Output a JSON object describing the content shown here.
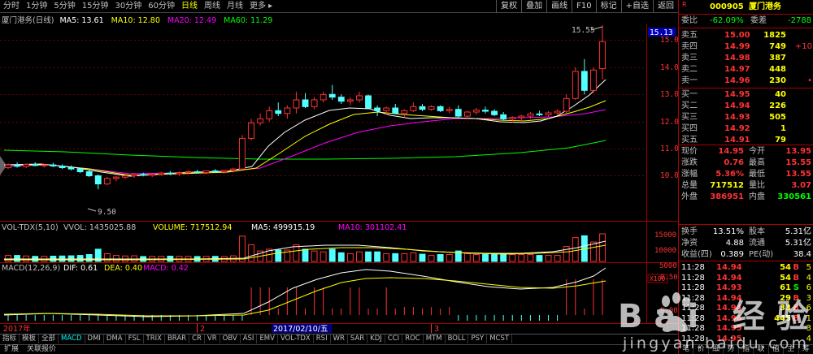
{
  "toolbar": {
    "timeframes": [
      "分时",
      "1分钟",
      "5分钟",
      "15分钟",
      "30分钟",
      "60分钟",
      "日线",
      "周线",
      "月线",
      "更多 ▸"
    ],
    "active_timeframe": "日线",
    "right_buttons": [
      "复权",
      "叠加",
      "画线",
      "F10",
      "标记",
      "+自选",
      "返回"
    ]
  },
  "info": {
    "stock": "厦门港务(日线)",
    "ma5": "MA5: 13.61",
    "ma10": "MA10: 12.80",
    "ma20": "MA20: 12.49",
    "ma60": "MA60: 11.29"
  },
  "price_axis": {
    "labels": [
      "15.00",
      "14.00",
      "13.00",
      "12.00",
      "11.00",
      "10.00"
    ],
    "current_price_tag": "15.13",
    "high_marker": "15.55",
    "low_marker": "9.50"
  },
  "volume_pane": {
    "title": "VOL-TDX(5,10)",
    "vvol": "VVOL: 1435025.88",
    "volume": "VOLUME: 717512.94",
    "ma5": "MA5: 499915.19",
    "ma10": "MA10: 301102.41",
    "axis_labels": [
      "15000",
      "10000",
      "5000"
    ],
    "unit": "X100"
  },
  "macd_pane": {
    "title": "MACD(12,26,9)",
    "dif": "DIF: 0.61",
    "dea": "DEA: 0.40",
    "macd": "MACD: 0.42",
    "axis_labels": [
      "0.50",
      "0.00"
    ]
  },
  "date_axis": {
    "year_label": "2017年",
    "month2": "2",
    "month3": "3",
    "cursor_date": "2017/02/10/五"
  },
  "indicator_tabs": [
    "指标",
    "模板",
    "全部",
    "MACD",
    "DMI",
    "DMA",
    "FSL",
    "TRIX",
    "BRAR",
    "CR",
    "VR",
    "OBV",
    "ASI",
    "EMV",
    "VOL-TDX",
    "RSI",
    "WR",
    "SAR",
    "KDJ",
    "CCI",
    "ROC",
    "MTM",
    "BOLL",
    "PSY",
    "MCST"
  ],
  "active_indicator": "MACD",
  "status_bar": [
    "扩展",
    "关联报价"
  ],
  "quote_panel": {
    "code": "000905",
    "name": "厦门港务",
    "weibi_label": "委比",
    "weibi": "-62.09%",
    "weicha_label": "委差",
    "weicha": "-2788",
    "asks": [
      {
        "label": "卖五",
        "price": "15.00",
        "vol": "1825",
        "chg": ""
      },
      {
        "label": "卖四",
        "price": "14.99",
        "vol": "749",
        "chg": "+10"
      },
      {
        "label": "卖三",
        "price": "14.98",
        "vol": "387",
        "chg": ""
      },
      {
        "label": "卖二",
        "price": "14.97",
        "vol": "448",
        "chg": ""
      },
      {
        "label": "卖一",
        "price": "14.96",
        "vol": "230",
        "chg": "•"
      }
    ],
    "bids": [
      {
        "label": "买一",
        "price": "14.95",
        "vol": "40"
      },
      {
        "label": "买二",
        "price": "14.94",
        "vol": "226"
      },
      {
        "label": "买三",
        "price": "14.93",
        "vol": "505"
      },
      {
        "label": "买四",
        "price": "14.92",
        "vol": "1"
      },
      {
        "label": "买五",
        "price": "14.91",
        "vol": "79"
      }
    ],
    "stats": [
      {
        "l1": "现价",
        "v1": "14.95",
        "l2": "今开",
        "v2": "13.95"
      },
      {
        "l1": "涨跌",
        "v1": "0.76",
        "l2": "最高",
        "v2": "15.55"
      },
      {
        "l1": "涨幅",
        "v1": "5.36%",
        "l2": "最低",
        "v2": "13.55"
      },
      {
        "l1": "总量",
        "v1": "717512",
        "l2": "量比",
        "v2": "3.07"
      },
      {
        "l1": "外盘",
        "v1": "386951",
        "l2": "内盘",
        "v2": "330561"
      }
    ],
    "stats2": [
      {
        "l1": "换手",
        "v1": "13.51%",
        "l2": "股本",
        "v2": "5.31亿"
      },
      {
        "l1": "净资",
        "v1": "4.88",
        "l2": "流通",
        "v2": "5.31亿"
      },
      {
        "l1": "收益(四)",
        "v1": "0.389",
        "l2": "PE(动)",
        "v2": "38.4"
      }
    ],
    "ticks": [
      {
        "time": "11:28",
        "price": "14.94",
        "vol": "54",
        "dir": "B",
        "n": "5"
      },
      {
        "time": "11:28",
        "price": "14.94",
        "vol": "54",
        "dir": "B",
        "n": "4"
      },
      {
        "time": "11:28",
        "price": "14.93",
        "vol": "61",
        "dir": "S",
        "n": "6"
      },
      {
        "time": "11:28",
        "price": "14.94",
        "vol": "29",
        "dir": "B",
        "n": "3"
      },
      {
        "time": "11:28",
        "price": "14.94",
        "vol": "33",
        "dir": "B",
        "n": "6"
      },
      {
        "time": "11:28",
        "price": "14.96",
        "vol": "445",
        "dir": "B",
        "n": "1"
      },
      {
        "time": "11:28",
        "price": "14.95",
        "vol": "",
        "dir": "",
        "n": "3"
      },
      {
        "time": "11:28",
        "price": "14.95",
        "vol": "",
        "dir": "",
        "n": "4"
      }
    ],
    "bottom_tabs": [
      "笔",
      "价",
      "细",
      "势",
      "指",
      "联",
      "值",
      "主",
      "筹"
    ]
  },
  "watermark": {
    "text": "Bai 经验",
    "url": "jingyan.baidu.com"
  },
  "colors": {
    "up": "#ff3232",
    "down": "#54ffff",
    "ma5": "#ffffff",
    "ma10": "#ffff00",
    "ma20": "#ff00ff",
    "ma60": "#00ff00",
    "axis": "#a00000"
  },
  "chart_data": {
    "type": "candlestick",
    "ylim": [
      9.3,
      15.8
    ],
    "candles": [
      [
        10.3,
        10.45,
        10.25,
        10.4
      ],
      [
        10.4,
        10.5,
        10.3,
        10.35
      ],
      [
        10.35,
        10.45,
        10.28,
        10.42
      ],
      [
        10.42,
        10.5,
        10.35,
        10.38
      ],
      [
        10.38,
        10.45,
        10.3,
        10.4
      ],
      [
        10.4,
        10.48,
        10.32,
        10.36
      ],
      [
        10.36,
        10.42,
        10.25,
        10.3
      ],
      [
        10.3,
        10.38,
        10.2,
        10.25
      ],
      [
        10.25,
        10.3,
        10.1,
        10.15
      ],
      [
        10.15,
        10.2,
        9.95,
        10.0
      ],
      [
        10.0,
        10.05,
        9.5,
        9.7
      ],
      [
        9.7,
        9.95,
        9.65,
        9.9
      ],
      [
        9.9,
        10.0,
        9.8,
        9.95
      ],
      [
        9.95,
        10.05,
        9.88,
        10.0
      ],
      [
        10.0,
        10.1,
        9.92,
        10.05
      ],
      [
        10.05,
        10.12,
        9.98,
        10.02
      ],
      [
        10.02,
        10.1,
        9.95,
        10.06
      ],
      [
        10.06,
        10.15,
        10.0,
        10.1
      ],
      [
        10.1,
        10.18,
        10.02,
        10.08
      ],
      [
        10.08,
        10.15,
        10.0,
        10.12
      ],
      [
        10.12,
        10.2,
        10.05,
        10.15
      ],
      [
        10.15,
        10.22,
        10.08,
        10.12
      ],
      [
        10.12,
        10.2,
        10.05,
        10.18
      ],
      [
        10.18,
        10.25,
        10.1,
        10.15
      ],
      [
        10.15,
        10.22,
        10.08,
        10.2
      ],
      [
        10.2,
        10.3,
        10.12,
        10.25
      ],
      [
        10.25,
        11.5,
        10.22,
        11.38
      ],
      [
        11.38,
        12.1,
        11.3,
        11.95
      ],
      [
        11.95,
        12.3,
        11.85,
        12.1
      ],
      [
        12.1,
        12.55,
        12.0,
        12.4
      ],
      [
        12.4,
        12.7,
        12.2,
        12.3
      ],
      [
        12.3,
        12.6,
        12.1,
        12.5
      ],
      [
        12.5,
        13.1,
        12.3,
        12.8
      ],
      [
        12.8,
        13.05,
        12.5,
        12.55
      ],
      [
        12.55,
        12.9,
        12.45,
        12.8
      ],
      [
        12.8,
        13.1,
        12.7,
        13.0
      ],
      [
        13.0,
        13.35,
        12.8,
        12.9
      ],
      [
        12.9,
        13.0,
        12.65,
        12.75
      ],
      [
        12.75,
        12.9,
        12.6,
        12.8
      ],
      [
        12.8,
        13.1,
        12.7,
        12.95
      ],
      [
        12.95,
        13.0,
        12.6,
        12.5
      ],
      [
        12.5,
        12.6,
        12.2,
        12.4
      ],
      [
        12.4,
        12.55,
        12.25,
        12.5
      ],
      [
        12.5,
        12.65,
        12.35,
        12.3
      ],
      [
        12.3,
        12.45,
        12.15,
        12.4
      ],
      [
        12.4,
        12.7,
        12.35,
        12.55
      ],
      [
        12.55,
        12.65,
        12.38,
        12.45
      ],
      [
        12.45,
        12.6,
        12.4,
        12.55
      ],
      [
        12.55,
        12.6,
        12.35,
        12.4
      ],
      [
        12.4,
        12.55,
        12.3,
        12.45
      ],
      [
        12.45,
        12.6,
        12.15,
        12.2
      ],
      [
        12.2,
        12.4,
        12.1,
        12.35
      ],
      [
        12.35,
        12.5,
        12.25,
        12.42
      ],
      [
        12.42,
        12.55,
        12.3,
        12.38
      ],
      [
        12.38,
        12.45,
        12.2,
        12.25
      ],
      [
        12.25,
        12.35,
        12.05,
        12.1
      ],
      [
        12.1,
        12.2,
        11.95,
        12.15
      ],
      [
        12.15,
        12.25,
        12.0,
        12.2
      ],
      [
        12.2,
        12.35,
        12.1,
        12.28
      ],
      [
        12.28,
        12.4,
        12.2,
        12.25
      ],
      [
        12.25,
        12.38,
        12.18,
        12.32
      ],
      [
        12.32,
        12.45,
        12.25,
        12.38
      ],
      [
        12.38,
        13.0,
        12.3,
        12.85
      ],
      [
        12.85,
        14.0,
        12.8,
        13.85
      ],
      [
        13.85,
        14.3,
        13.0,
        13.15
      ],
      [
        13.15,
        14.0,
        13.05,
        13.9
      ],
      [
        13.95,
        15.55,
        13.55,
        14.95
      ]
    ]
  }
}
